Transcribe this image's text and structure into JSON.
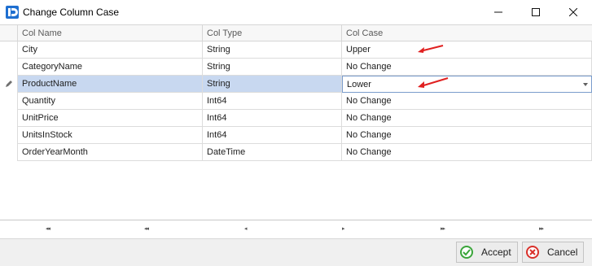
{
  "window": {
    "title": "Change Column Case",
    "icons": {
      "app": "app-logo-icon",
      "minimize": "minimize-icon",
      "maximize": "maximize-icon",
      "close": "close-icon"
    }
  },
  "grid": {
    "columns": [
      "Col Name",
      "Col Type",
      "Col Case"
    ],
    "rows": [
      {
        "name": "City",
        "type": "String",
        "case": "Upper"
      },
      {
        "name": "CategoryName",
        "type": "String",
        "case": "No Change"
      },
      {
        "name": "ProductName",
        "type": "String",
        "case": "Lower"
      },
      {
        "name": "Quantity",
        "type": "Int64",
        "case": "No Change"
      },
      {
        "name": "UnitPrice",
        "type": "Int64",
        "case": "No Change"
      },
      {
        "name": "UnitsInStock",
        "type": "Int64",
        "case": "No Change"
      },
      {
        "name": "OrderYearMonth",
        "type": "DateTime",
        "case": "No Change"
      }
    ],
    "selected_row": 2,
    "colors": {
      "selection": "#c8d8f0",
      "annotation_arrow": "#e02020"
    }
  },
  "navigator": {
    "first": "◂◂",
    "prev_page": "◂◂",
    "prev": "◂",
    "next": "▸",
    "next_page": "▸▸",
    "last": "▸▸"
  },
  "footer": {
    "accept_label": "Accept",
    "cancel_label": "Cancel",
    "icons": {
      "accept": "check-icon",
      "cancel": "cancel-icon"
    },
    "colors": {
      "accept": "#3aa53a",
      "cancel": "#d9302a"
    }
  }
}
